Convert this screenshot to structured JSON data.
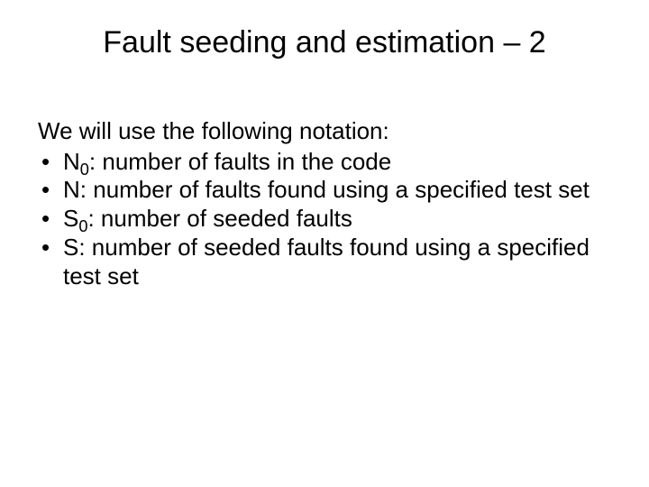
{
  "title": "Fault seeding and estimation – 2",
  "intro": "We will use the following notation:",
  "bullets": [
    {
      "sym": "N",
      "sub": "0",
      "desc": ": number of faults in the code"
    },
    {
      "sym": "N",
      "sub": "",
      "desc": ": number of faults found using a specified test set"
    },
    {
      "sym": "S",
      "sub": "0",
      "desc": ": number of seeded faults"
    },
    {
      "sym": "S",
      "sub": "",
      "desc": ": number of seeded faults found using a specified test set"
    }
  ],
  "bullet_char": "•"
}
